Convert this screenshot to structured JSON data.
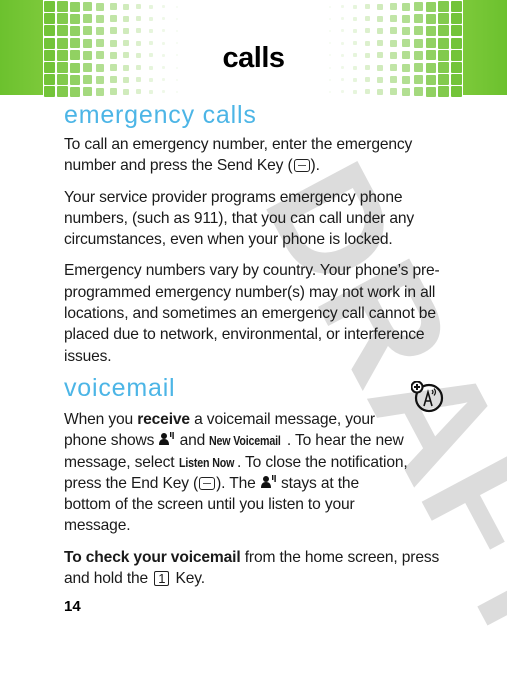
{
  "header": {
    "title": "calls",
    "accent_color": "#6cc12e"
  },
  "watermark": "DRAFT",
  "sections": [
    {
      "heading": "emergency calls",
      "paragraphs": [
        {
          "before_key": "To call an emergency number, enter the emergency number and press the Send Key (",
          "key_icon": "send-key-icon",
          "after_key": ")."
        },
        {
          "text": "Your service provider programs emergency phone numbers, (such as 911), that you can call under any circumstances, even when your phone is locked."
        },
        {
          "text": "Emergency numbers vary by country. Your phone’s pre-programmed emergency number(s) may not work in all locations, and sometimes an emergency call cannot be placed due to network, environmental, or interference issues."
        }
      ]
    },
    {
      "heading": "voicemail",
      "feature_icon": "network-feature-icon",
      "p1": {
        "t1": "When you ",
        "b1": "receive",
        "t2": " a voicemail message, your phone shows ",
        "icon1": "voicemail-icon",
        "t3": " and ",
        "ui1": "New Voicemail",
        "t4": ". To hear the new message, select ",
        "ui2": "Listen Now",
        "t5": ". To close the notification, press the End Key (",
        "key_icon": "end-key-icon",
        "t6": "). The ",
        "icon2": "voicemail-icon",
        "t7": " stays at the bottom of the screen until you listen to your message."
      },
      "p2": {
        "b1": "To check your voicemail",
        "t1": " from the home screen, press and hold the ",
        "key": "1",
        "t2": " Key."
      }
    }
  ],
  "footer": {
    "page_number": "14"
  }
}
